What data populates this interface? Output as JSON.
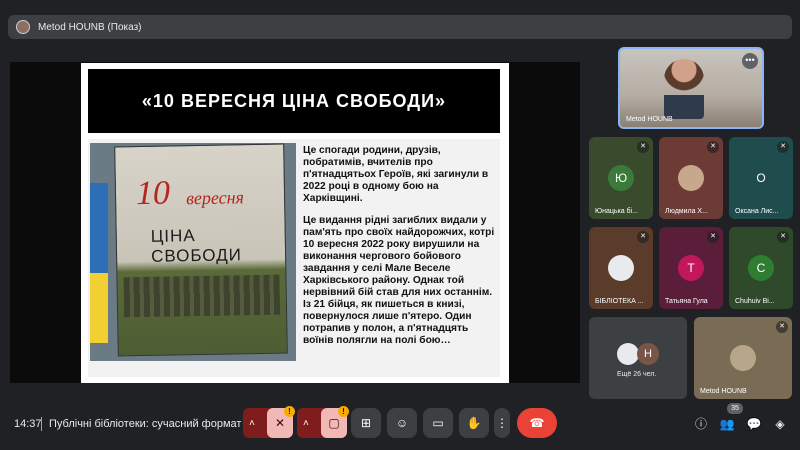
{
  "presenter": {
    "title": "Metod HOUNB (Показ)"
  },
  "slide": {
    "header": "«10 ВЕРЕСНЯ  ЦІНА СВОБОДИ»",
    "book_cover_num": "10",
    "book_cover_word": "вересня",
    "book_cover_sub": "ЦІНА СВОБОДИ",
    "para1": "Це спогади родини, друзів, побратимів, вчителів про п'ятнадцятьох Героїв, які загинули в 2022 році в одному бою на Харківщині.",
    "para2_lines": [
      "Це видання  рідні загиблих видали  у пам'ять про своїх найдорожчих, котрі",
      "10 вересня 2022 року вирушили на виконання чергового бойового завдання у селі Мале Веселе Харківського району. Однак той нервівний бій став для них останнім. Із 21 бійця, як пишеться в книзі, повернулося лише п'ятеро. Один потрапив у полон, а п'ятнадцять воїнів полягли на полі бою…"
    ]
  },
  "participants": {
    "main": {
      "name": "Metod HOUNB",
      "more_icon": "more-dots-icon"
    },
    "tiles": [
      {
        "name": "Юнацька бі...",
        "initial": "Ю",
        "color": "#3b7a3b",
        "bg": "#3a4a2c",
        "muted": true
      },
      {
        "name": "Людмила Х...",
        "initial": "",
        "color": "#c8a88a",
        "bg": "#6d3b35",
        "muted": true
      },
      {
        "name": "Оксана Лис...",
        "initial": "О",
        "color": "#1f4d4d",
        "bg": "#1f4d4d",
        "muted": true
      },
      {
        "name": "БІБЛІОТЕКА ...",
        "initial": "",
        "color": "#e8eaed",
        "bg": "#5b3b2a",
        "muted": true
      },
      {
        "name": "Татьяна Гула",
        "initial": "Т",
        "color": "#c2185b",
        "bg": "#5a1e3b",
        "muted": true
      },
      {
        "name": "Chuhuiv Bi...",
        "initial": "С",
        "color": "#2e7d32",
        "bg": "#2f4a2a",
        "muted": true
      }
    ],
    "others": {
      "label": "Ещё 26 чел.",
      "initial": "Н"
    },
    "self": {
      "name": "Metod HOUNB"
    }
  },
  "bottom_bar": {
    "time": "14:37",
    "meeting_title": "Публічні бібліотеки: сучасний формат",
    "participant_count": "35",
    "warning": "!"
  },
  "colors": {
    "accent": "#8ab4f8",
    "danger": "#ea4335",
    "muted_btn": "#e8a0a0",
    "bar_bg": "#3c4043"
  }
}
